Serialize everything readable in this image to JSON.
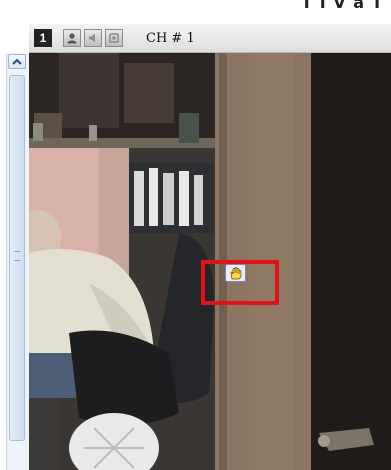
{
  "header": {
    "title_fragment": "T I V a T I"
  },
  "channel": {
    "number": "1",
    "label": "CH # 1"
  },
  "header_icons": [
    "person-icon",
    "speaker-icon",
    "record-icon"
  ],
  "scrollbar": {
    "up_icon": "chevron-up-icon",
    "grip_icon": "grip-icon"
  },
  "cursor": {
    "icon": "hand-cursor-icon"
  },
  "colors": {
    "marker": "#e0121a",
    "header_bg": "#e6e6e6",
    "scroll_bg": "#eef3fa"
  }
}
